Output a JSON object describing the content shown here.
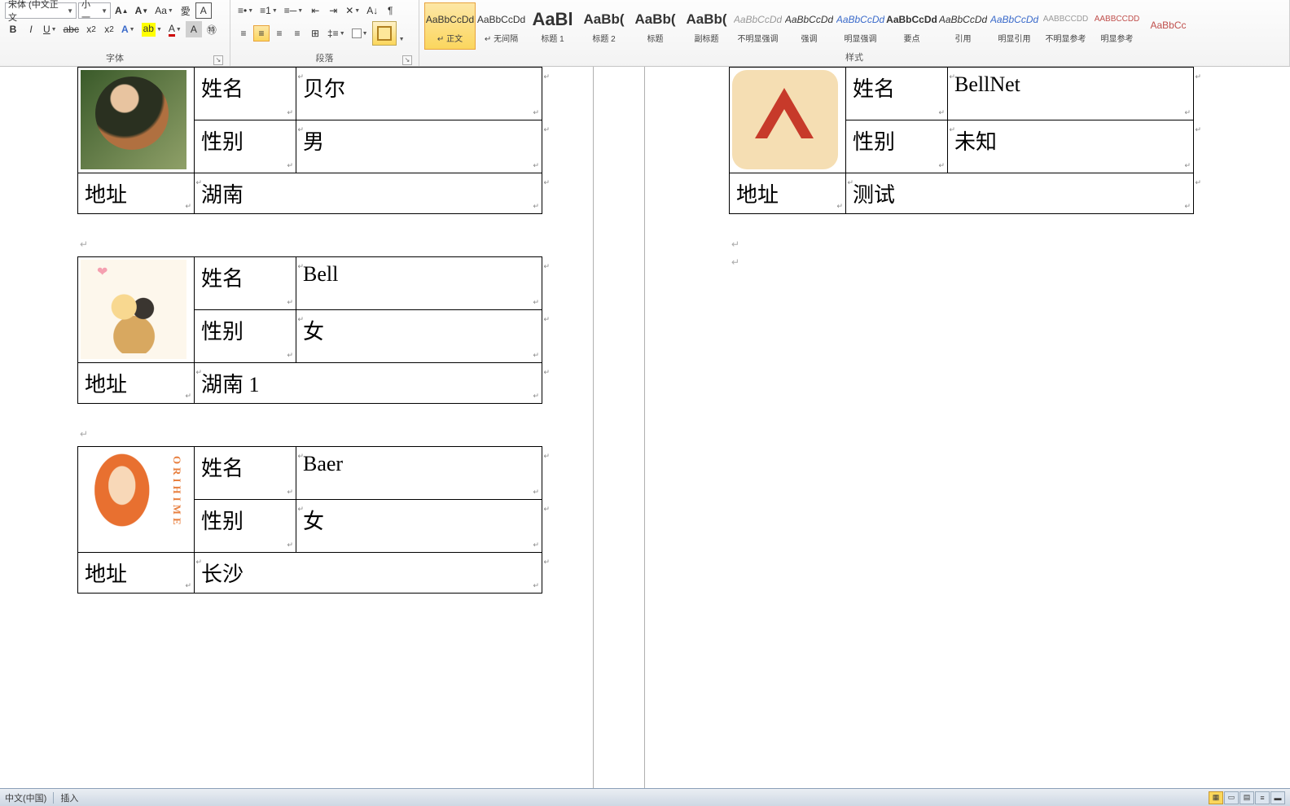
{
  "ribbon": {
    "font": {
      "name": "宋体 (中文正文",
      "size": "小一",
      "group_label": "字体"
    },
    "para": {
      "group_label": "段落"
    },
    "styles": {
      "group_label": "样式",
      "items": [
        {
          "preview": "AaBbCcDd",
          "name": "↵ 正文",
          "cls": ""
        },
        {
          "preview": "AaBbCcDd",
          "name": "↵ 无间隔",
          "cls": ""
        },
        {
          "preview": "AaBl",
          "name": "标题 1",
          "cls": "big"
        },
        {
          "preview": "AaBb(",
          "name": "标题 2",
          "cls": "mid"
        },
        {
          "preview": "AaBb(",
          "name": "标题",
          "cls": "mid"
        },
        {
          "preview": "AaBb(",
          "name": "副标题",
          "cls": "mid"
        },
        {
          "preview": "AaBbCcDd",
          "name": "不明显强调",
          "cls": "ital gray"
        },
        {
          "preview": "AaBbCcDd",
          "name": "强调",
          "cls": "ital"
        },
        {
          "preview": "AaBbCcDd",
          "name": "明显强调",
          "cls": "ital blue"
        },
        {
          "preview": "AaBbCcDd",
          "name": "要点",
          "cls": "bold"
        },
        {
          "preview": "AaBbCcDd",
          "name": "引用",
          "cls": "ital"
        },
        {
          "preview": "AaBbCcDd",
          "name": "明显引用",
          "cls": "ital blue"
        },
        {
          "preview": "AABBCCDD",
          "name": "不明显参考",
          "cls": "small gray"
        },
        {
          "preview": "AABBCCDD",
          "name": "明显参考",
          "cls": "small red"
        },
        {
          "preview": "AaBbCc",
          "name": "",
          "cls": "red"
        }
      ]
    }
  },
  "doc": {
    "labels": {
      "name": "姓名",
      "gender": "性别",
      "addr": "地址"
    },
    "cards_left": [
      {
        "name": "贝尔",
        "gender": "男",
        "addr": "湖南",
        "av": "av1"
      },
      {
        "name": "Bell",
        "gender": "女",
        "addr": "湖南 1",
        "av": "av2"
      },
      {
        "name": "Baer",
        "gender": "女",
        "addr": "长沙",
        "av": "av3"
      }
    ],
    "cards_right": [
      {
        "name": "BellNet",
        "gender": "未知",
        "addr": "测试",
        "av": "av4"
      }
    ]
  },
  "status": {
    "lang": "中文(中国)",
    "mode": "插入"
  }
}
